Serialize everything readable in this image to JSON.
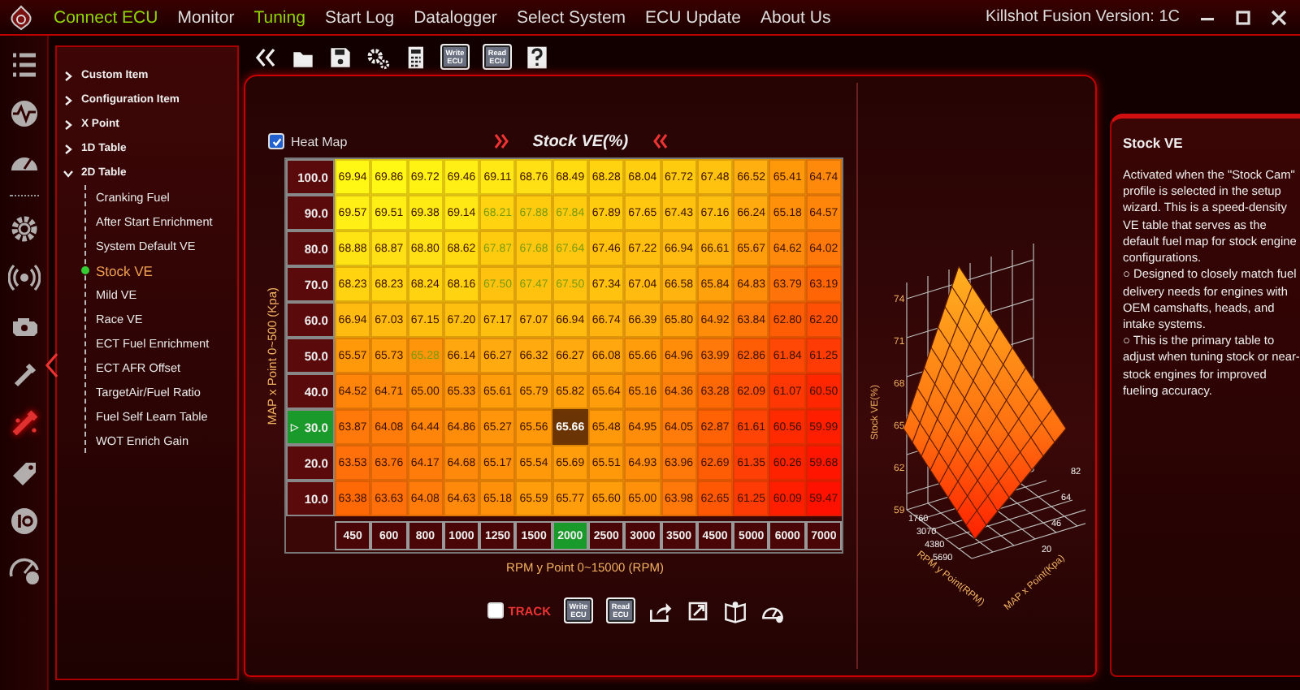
{
  "title_bar": {
    "menu": [
      {
        "label": "Connect ECU",
        "active": true
      },
      {
        "label": "Monitor",
        "active": false
      },
      {
        "label": "Tuning",
        "active": true
      },
      {
        "label": "Start Log",
        "active": false
      },
      {
        "label": "Datalogger",
        "active": false
      },
      {
        "label": "Select System",
        "active": false
      },
      {
        "label": "ECU Update",
        "active": false
      },
      {
        "label": "About Us",
        "active": false
      }
    ],
    "title": "Killshot Fusion Version: 1C"
  },
  "icons": [
    {
      "kind": "menu",
      "selected": false
    },
    {
      "kind": "waveform",
      "selected": false
    },
    {
      "kind": "gauge",
      "selected": false
    },
    {
      "kind": "gear",
      "selected": false
    },
    {
      "kind": "broadcast",
      "selected": false
    },
    {
      "kind": "engine",
      "selected": false
    },
    {
      "kind": "spark",
      "selected": false
    },
    {
      "kind": "injector",
      "selected": true
    },
    {
      "kind": "tag",
      "selected": false
    },
    {
      "kind": "io",
      "selected": false
    },
    {
      "kind": "meter",
      "selected": false
    }
  ],
  "tree": {
    "items": [
      {
        "label": "Custom Item",
        "expanded": false
      },
      {
        "label": "Configuration Item",
        "expanded": false
      },
      {
        "label": "X Point",
        "expanded": false
      },
      {
        "label": "1D Table",
        "expanded": false
      },
      {
        "label": "2D Table",
        "expanded": true,
        "children": [
          {
            "label": "Cranking Fuel",
            "selected": false
          },
          {
            "label": "After Start Enrichment",
            "selected": false
          },
          {
            "label": "System Default VE",
            "selected": false
          },
          {
            "label": "Stock VE",
            "selected": true
          },
          {
            "label": "Mild VE",
            "selected": false
          },
          {
            "label": "Race VE",
            "selected": false
          },
          {
            "label": "ECT Fuel Enrichment",
            "selected": false
          },
          {
            "label": "ECT AFR Offset",
            "selected": false
          },
          {
            "label": "TargetAir/Fuel Ratio",
            "selected": false
          },
          {
            "label": "Fuel Self Learn Table",
            "selected": false
          },
          {
            "label": "WOT Enrich Gain",
            "selected": false
          }
        ]
      }
    ]
  },
  "toolbar": [
    {
      "kind": "collapse"
    },
    {
      "kind": "open"
    },
    {
      "kind": "save"
    },
    {
      "kind": "settings"
    },
    {
      "kind": "calculator"
    },
    {
      "kind": "chip",
      "label": "Write ECU"
    },
    {
      "kind": "chip",
      "label": "Read ECU"
    },
    {
      "kind": "help"
    }
  ],
  "table": {
    "heat_map_label": "Heat Map",
    "heat_map": true,
    "title": "Stock VE(%)",
    "y_label": "MAP x Point 0~500 (Kpa)",
    "x_label": "RPM y Point 0~15000 (RPM)",
    "pointer": "▷",
    "rows": [
      {
        "label": "100.0",
        "selected": false,
        "cells": [
          "69.94",
          "69.86",
          "69.72",
          "69.46",
          "69.11",
          "68.76",
          "68.49",
          "68.28",
          "68.04",
          "67.72",
          "67.48",
          "66.52",
          "65.41",
          "64.74"
        ],
        "highlighted": [
          false,
          false,
          false,
          false,
          false,
          false,
          false,
          false,
          false,
          false,
          false,
          false,
          false,
          false
        ]
      },
      {
        "label": "90.0",
        "selected": false,
        "cells": [
          "69.57",
          "69.51",
          "69.38",
          "69.14",
          "68.21",
          "67.88",
          "67.84",
          "67.89",
          "67.65",
          "67.43",
          "67.16",
          "66.24",
          "65.18",
          "64.57"
        ],
        "highlighted": [
          false,
          false,
          false,
          false,
          true,
          true,
          true,
          false,
          false,
          false,
          false,
          false,
          false,
          false
        ]
      },
      {
        "label": "80.0",
        "selected": false,
        "cells": [
          "68.88",
          "68.87",
          "68.80",
          "68.62",
          "67.87",
          "67.68",
          "67.64",
          "67.46",
          "67.22",
          "66.94",
          "66.61",
          "65.67",
          "64.62",
          "64.02"
        ],
        "highlighted": [
          false,
          false,
          false,
          false,
          true,
          true,
          true,
          false,
          false,
          false,
          false,
          false,
          false,
          false
        ]
      },
      {
        "label": "70.0",
        "selected": false,
        "cells": [
          "68.23",
          "68.23",
          "68.24",
          "68.16",
          "67.50",
          "67.47",
          "67.50",
          "67.34",
          "67.04",
          "66.58",
          "65.84",
          "64.83",
          "63.79",
          "63.19"
        ],
        "highlighted": [
          false,
          false,
          false,
          false,
          true,
          true,
          true,
          false,
          false,
          false,
          false,
          false,
          false,
          false
        ]
      },
      {
        "label": "60.0",
        "selected": false,
        "cells": [
          "66.94",
          "67.03",
          "67.15",
          "67.20",
          "67.17",
          "67.07",
          "66.94",
          "66.74",
          "66.39",
          "65.80",
          "64.92",
          "63.84",
          "62.80",
          "62.20"
        ],
        "highlighted": [
          false,
          false,
          false,
          false,
          false,
          false,
          false,
          false,
          false,
          false,
          false,
          false,
          false,
          false
        ]
      },
      {
        "label": "50.0",
        "selected": false,
        "cells": [
          "65.57",
          "65.73",
          "65.28",
          "66.14",
          "66.27",
          "66.32",
          "66.27",
          "66.08",
          "65.66",
          "64.96",
          "63.99",
          "62.86",
          "61.84",
          "61.25"
        ],
        "highlighted": [
          false,
          false,
          true,
          false,
          false,
          false,
          false,
          false,
          false,
          false,
          false,
          false,
          false,
          false
        ]
      },
      {
        "label": "40.0",
        "selected": false,
        "cells": [
          "64.52",
          "64.71",
          "65.00",
          "65.33",
          "65.61",
          "65.79",
          "65.82",
          "65.64",
          "65.16",
          "64.36",
          "63.28",
          "62.09",
          "61.07",
          "60.50"
        ],
        "highlighted": [
          false,
          false,
          false,
          false,
          false,
          false,
          false,
          false,
          false,
          false,
          false,
          false,
          false,
          false
        ]
      },
      {
        "label": "30.0",
        "selected": true,
        "cells": [
          "63.87",
          "64.08",
          "64.44",
          "64.86",
          "65.27",
          "65.56",
          "65.66",
          "65.48",
          "64.95",
          "64.05",
          "62.87",
          "61.61",
          "60.56",
          "59.99"
        ],
        "highlighted": [
          false,
          false,
          false,
          false,
          false,
          false,
          false,
          false,
          false,
          false,
          false,
          false,
          false,
          false
        ]
      },
      {
        "label": "20.0",
        "selected": false,
        "cells": [
          "63.53",
          "63.76",
          "64.17",
          "64.68",
          "65.17",
          "65.54",
          "65.69",
          "65.51",
          "64.93",
          "63.96",
          "62.69",
          "61.35",
          "60.26",
          "59.68"
        ],
        "highlighted": [
          false,
          false,
          false,
          false,
          false,
          false,
          false,
          false,
          false,
          false,
          false,
          false,
          false,
          false
        ]
      },
      {
        "label": "10.0",
        "selected": false,
        "cells": [
          "63.38",
          "63.63",
          "64.08",
          "64.63",
          "65.18",
          "65.59",
          "65.77",
          "65.60",
          "65.00",
          "63.98",
          "62.65",
          "61.25",
          "60.09",
          "59.47"
        ],
        "highlighted": [
          false,
          false,
          false,
          false,
          false,
          false,
          false,
          false,
          false,
          false,
          false,
          false,
          false,
          false
        ]
      }
    ],
    "x_points": [
      {
        "label": "450",
        "selected": false
      },
      {
        "label": "600",
        "selected": false
      },
      {
        "label": "800",
        "selected": false
      },
      {
        "label": "1000",
        "selected": false
      },
      {
        "label": "1250",
        "selected": false
      },
      {
        "label": "1500",
        "selected": false
      },
      {
        "label": "2000",
        "selected": true
      },
      {
        "label": "2500",
        "selected": false
      },
      {
        "label": "3000",
        "selected": false
      },
      {
        "label": "3500",
        "selected": false
      },
      {
        "label": "4500",
        "selected": false
      },
      {
        "label": "5000",
        "selected": false
      },
      {
        "label": "6000",
        "selected": false
      },
      {
        "label": "7000",
        "selected": false
      }
    ],
    "track_label": "TRACK",
    "track": false,
    "bottom_tools": [
      {
        "kind": "chip",
        "label": "Write ECU"
      },
      {
        "kind": "chip",
        "label": "Read ECU"
      },
      {
        "kind": "share"
      },
      {
        "kind": "export"
      },
      {
        "kind": "book"
      },
      {
        "kind": "gauge"
      }
    ]
  },
  "surface_view": {
    "z_label": "Stock VE(%)",
    "z_ticks": [
      "74",
      "71",
      "68",
      "65",
      "62",
      "59"
    ],
    "rpm_label": "RPM y Point(RPM)",
    "rpm_ticks": [
      "1760",
      "3070",
      "4380",
      "5690"
    ],
    "map_label": "MAP x Point(Kpa)",
    "map_ticks": [
      "20",
      "46",
      "64",
      "82"
    ]
  },
  "info": {
    "title": "Stock VE",
    "paragraphs": [
      "Activated when the  \"Stock Cam\" profile is selected in the setup wizard. This is a speed-density VE table that serves as the default fuel map for stock engine configurations.",
      "○ Designed to closely match fuel delivery needs for engines with OEM camshafts, heads, and intake systems.",
      "○ This is the primary table to adjust when tuning stock or near-stock engines for improved fueling accuracy."
    ]
  }
}
